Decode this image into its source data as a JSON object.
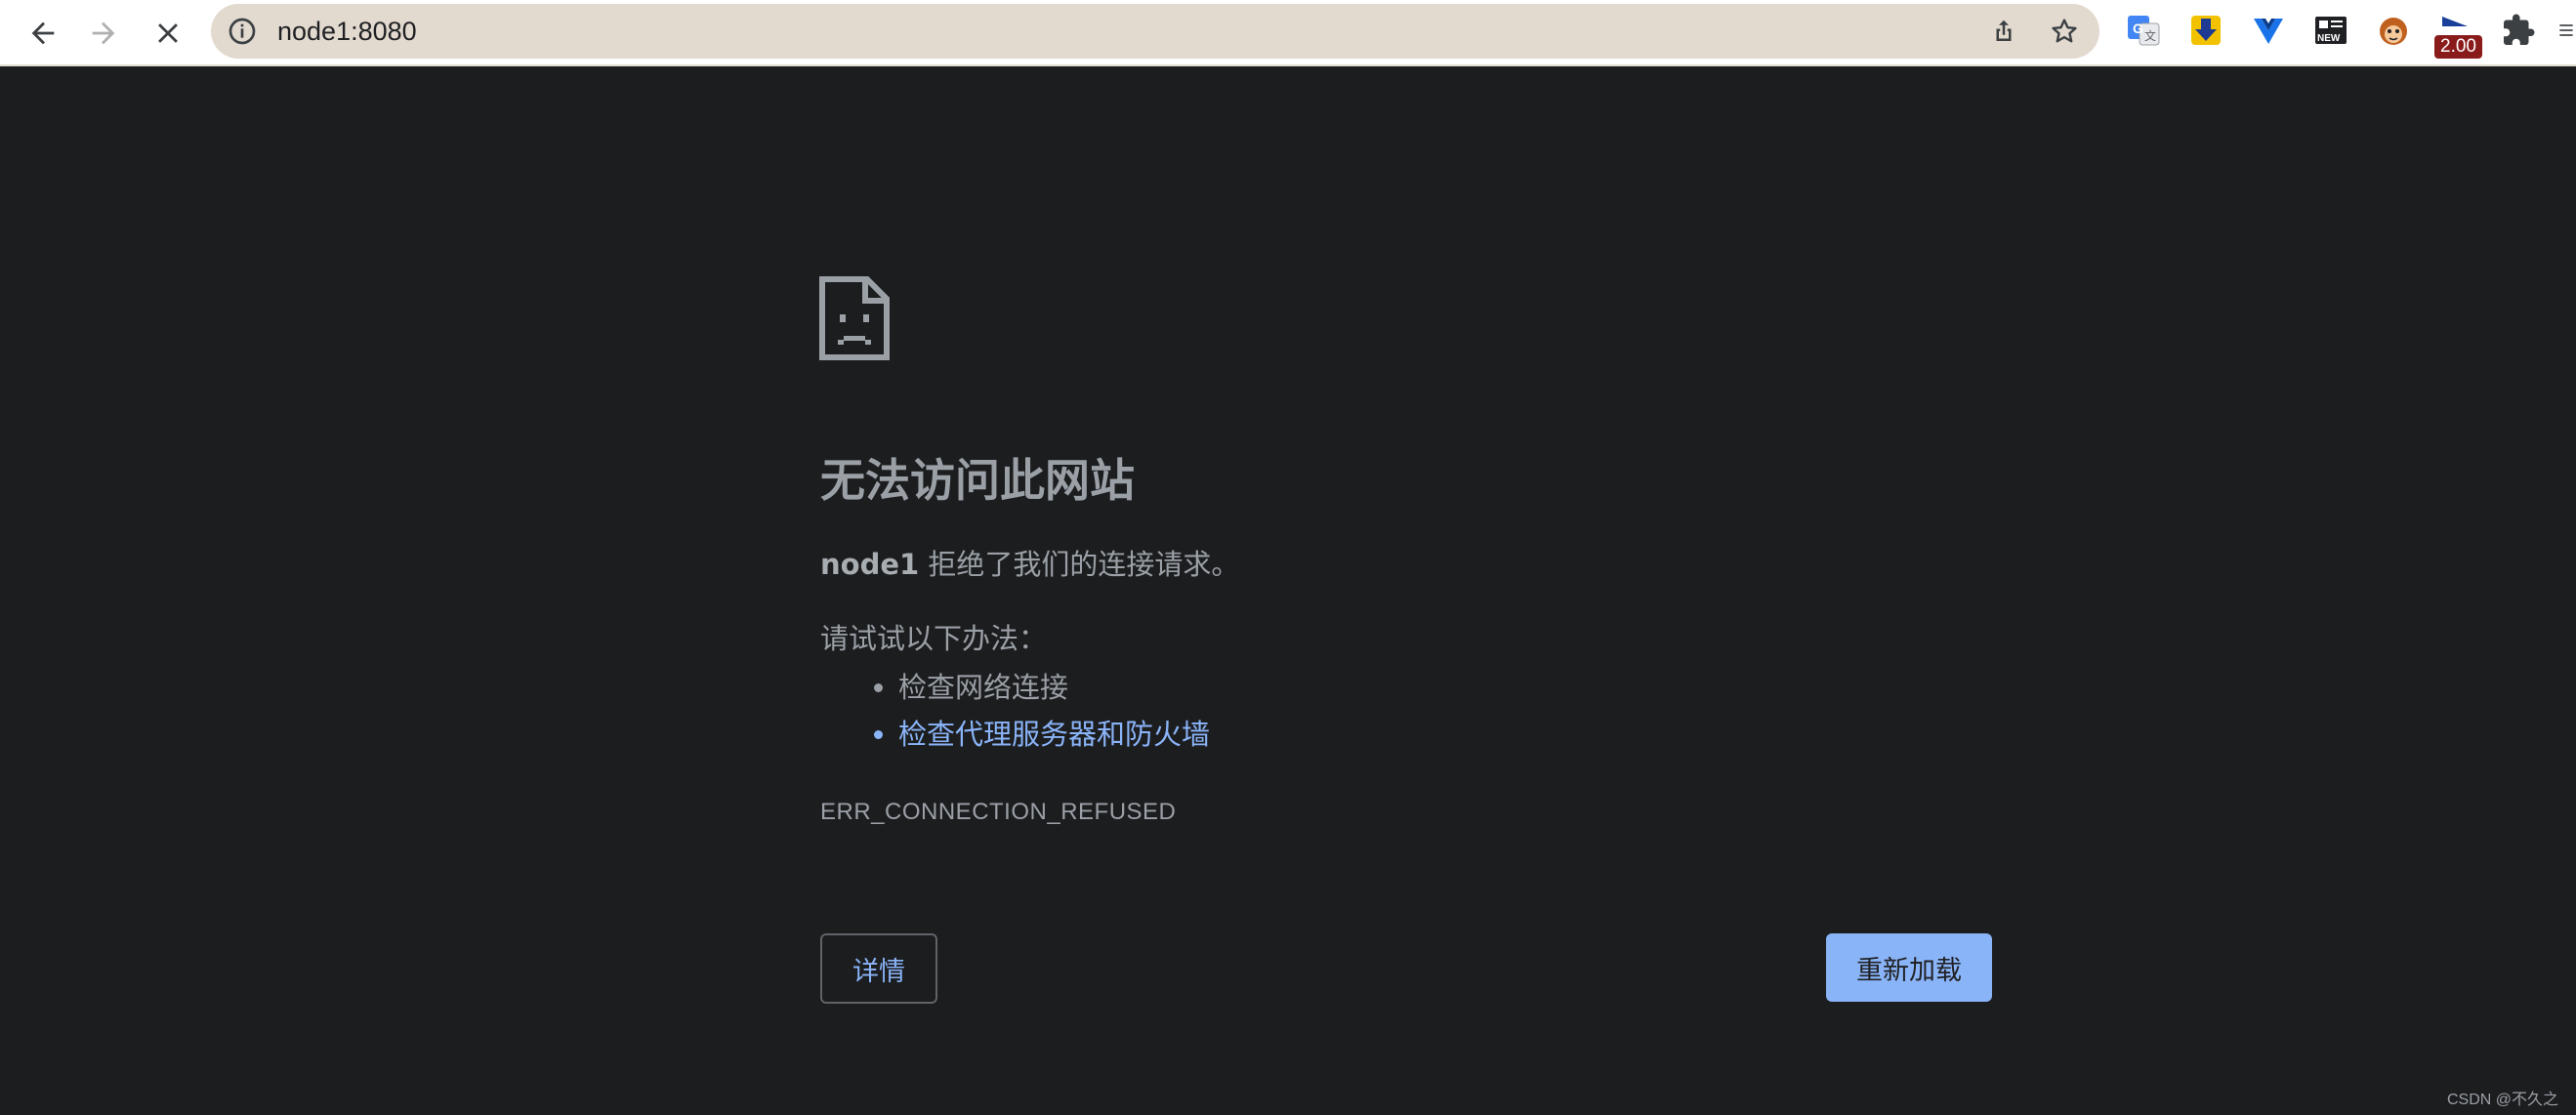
{
  "browser": {
    "url": "node1:8080",
    "extension_badge": "2.00"
  },
  "icons": {
    "back": "arrow-left-icon",
    "forward": "arrow-right-icon",
    "stop": "close-icon",
    "site_info": "info-icon",
    "share": "share-icon",
    "bookmark": "star-icon",
    "extensions": "puzzle-icon",
    "menu": "menu-icon"
  },
  "error_page": {
    "title": "无法访问此网站",
    "host": "node1",
    "message": " 拒绝了我们的连接请求。",
    "try_heading": "请试试以下办法：",
    "suggestions": [
      "检查网络连接",
      "检查代理服务器和防火墙"
    ],
    "error_code": "ERR_CONNECTION_REFUSED",
    "details_label": "详情",
    "reload_label": "重新加载"
  },
  "watermark": "CSDN @不久之",
  "colors": {
    "page_bg": "#1c1d1f",
    "text": "#9aa0a6",
    "link": "#8ab4f8",
    "reload_bg": "#8ab4f8",
    "omnibox_bg": "#e2d9cf"
  }
}
